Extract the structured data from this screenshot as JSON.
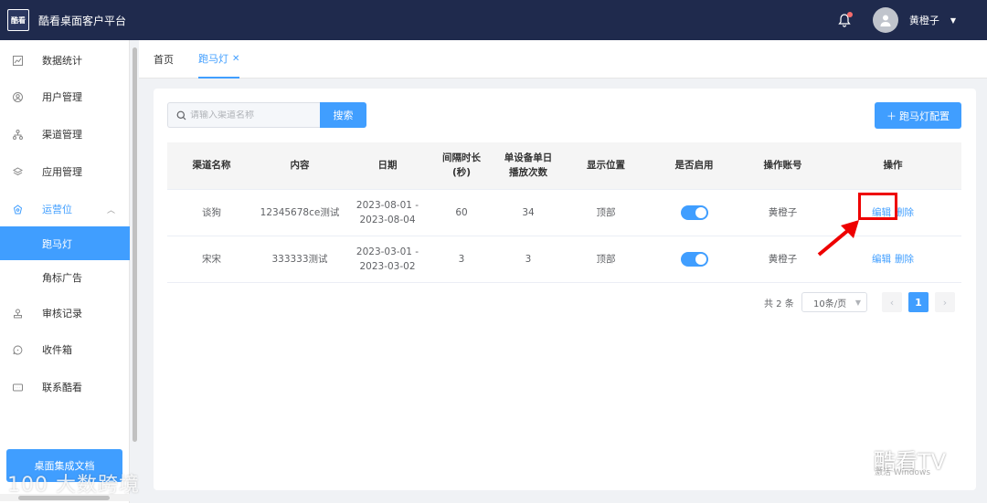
{
  "header": {
    "logo_text": "酷看",
    "app_title": "酷看桌面客户平台",
    "user_name": "黄橙子",
    "icons": [
      "bell-icon",
      "avatar-icon",
      "caret-down-icon"
    ],
    "notification_dot_color": "#f56c6c"
  },
  "sidebar": {
    "items": [
      {
        "label": "数据统计",
        "icon": "chart-icon"
      },
      {
        "label": "用户管理",
        "icon": "user-icon"
      },
      {
        "label": "渠道管理",
        "icon": "channel-icon"
      },
      {
        "label": "应用管理",
        "icon": "layers-icon"
      },
      {
        "label": "运营位",
        "icon": "operation-icon",
        "expanded": true
      },
      {
        "label": "跑马灯",
        "sub": true,
        "selected": true
      },
      {
        "label": "角标广告",
        "sub": true
      },
      {
        "label": "审核记录",
        "icon": "audit-icon"
      },
      {
        "label": "收件箱",
        "icon": "inbox-icon"
      },
      {
        "label": "联系酷看",
        "icon": "contact-icon"
      }
    ],
    "doc_button": "桌面集成文档"
  },
  "tabs": [
    {
      "label": "首页",
      "active": false
    },
    {
      "label": "跑马灯",
      "active": true,
      "closable": true
    }
  ],
  "toolbar": {
    "search_placeholder": "请输入渠道名称",
    "search_button": "搜索",
    "config_button": "跑马灯配置",
    "config_icon": "plus-icon"
  },
  "table": {
    "headers": [
      "渠道名称",
      "内容",
      "日期",
      "间隔时长\n(秒)",
      "单设备单日\n播放次数",
      "显示位置",
      "是否启用",
      "操作账号",
      "操作"
    ],
    "rows": [
      {
        "channel": "谈狗",
        "content": "12345678ce测试",
        "date": "2023-08-01 - 2023-08-04",
        "interval": "60",
        "plays": "34",
        "position": "顶部",
        "enabled": true,
        "account": "黄橙子",
        "edit": "编辑",
        "delete": "删除"
      },
      {
        "channel": "宋宋",
        "content": "333333测试",
        "date": "2023-03-01 - 2023-03-02",
        "interval": "3",
        "plays": "3",
        "position": "顶部",
        "enabled": true,
        "account": "黄橙子",
        "edit": "编辑",
        "delete": "删除"
      }
    ]
  },
  "pagination": {
    "total": "共 2 条",
    "page_size": "10条/页",
    "current_page": "1"
  },
  "watermarks": {
    "left": "100 大数跨境",
    "right": "酷看TV",
    "windows": "激活 Windows"
  },
  "colors": {
    "accent": "#409eff",
    "header_bg": "#1f2a4d",
    "highlight": "#ee0000"
  }
}
